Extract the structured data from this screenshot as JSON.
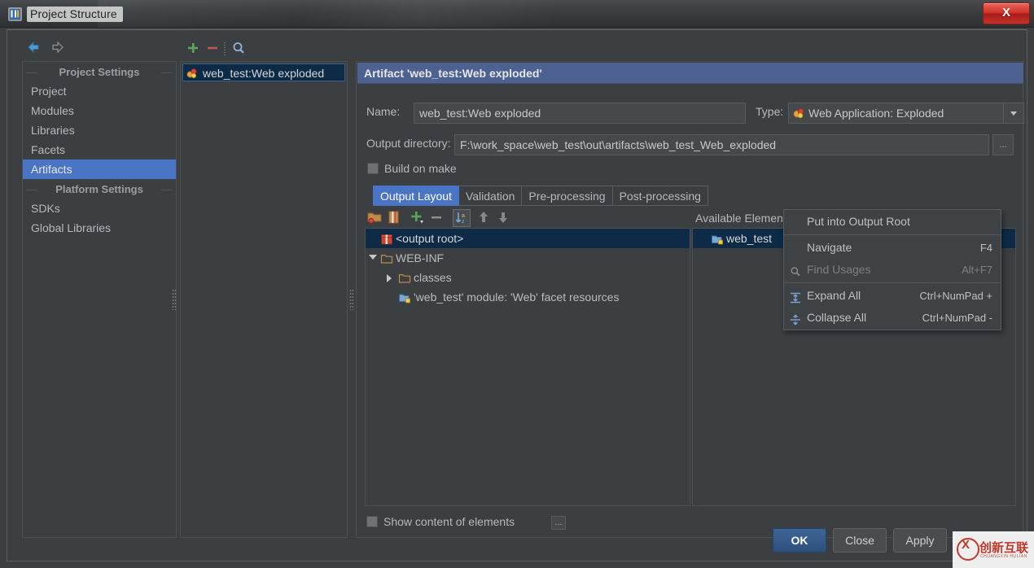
{
  "window": {
    "title": "Project Structure",
    "app_icon": "intellij-idea-icon",
    "close_label": "X"
  },
  "nav": {
    "back_icon": "arrow-left-icon",
    "forward_icon": "arrow-right-icon"
  },
  "sidebar": {
    "groups": [
      {
        "title": "Project Settings",
        "items": [
          {
            "label": "Project",
            "selected": false
          },
          {
            "label": "Modules",
            "selected": false
          },
          {
            "label": "Libraries",
            "selected": false
          },
          {
            "label": "Facets",
            "selected": false
          },
          {
            "label": "Artifacts",
            "selected": true
          }
        ]
      },
      {
        "title": "Platform Settings",
        "items": [
          {
            "label": "SDKs",
            "selected": false
          },
          {
            "label": "Global Libraries",
            "selected": false
          }
        ]
      }
    ]
  },
  "artifacts_panel": {
    "toolbar": {
      "add_icon": "plus-icon",
      "remove_icon": "minus-icon",
      "find_icon": "search-icon"
    },
    "items": [
      {
        "label": "web_test:Web exploded",
        "icon": "artifact-exploded-icon",
        "selected": true
      }
    ]
  },
  "details": {
    "header": "Artifact 'web_test:Web exploded'",
    "name_label": "Name:",
    "name_value": "web_test:Web exploded",
    "type_label": "Type:",
    "type_value": "Web Application: Exploded",
    "type_icon": "web-application-icon",
    "type_dropdown_icon": "chevron-down-icon",
    "output_dir_label": "Output directory:",
    "output_dir_value": "F:\\work_space\\web_test\\out\\artifacts\\web_test_Web_exploded",
    "output_dir_browse": "...",
    "build_on_make_label": "Build on make",
    "build_on_make_checked": false,
    "tabs": [
      {
        "label": "Output Layout",
        "active": true
      },
      {
        "label": "Validation",
        "active": false
      },
      {
        "label": "Pre-processing",
        "active": false
      },
      {
        "label": "Post-processing",
        "active": false
      }
    ],
    "layout_toolbar": [
      {
        "icon": "create-directory-icon",
        "framed": false
      },
      {
        "icon": "create-archive-icon",
        "framed": false
      },
      {
        "icon": "add-copy-of-icon",
        "framed": false
      },
      {
        "icon": "remove-icon",
        "framed": false
      },
      {
        "icon": "sort-alphabetically-icon",
        "framed": true
      },
      {
        "icon": "move-up-icon",
        "framed": false
      },
      {
        "icon": "move-down-icon",
        "framed": false
      }
    ],
    "tree": [
      {
        "label": "<output root>",
        "icon": "output-root-icon",
        "indent": 0,
        "twisty": "none",
        "selected": true
      },
      {
        "label": "WEB-INF",
        "icon": "folder-icon",
        "indent": 0,
        "twisty": "open",
        "selected": false
      },
      {
        "label": "classes",
        "icon": "folder-icon",
        "indent": 1,
        "twisty": "closed",
        "selected": false
      },
      {
        "label": "'web_test' module: 'Web' facet resources",
        "icon": "module-facet-icon",
        "indent": 1,
        "twisty": "none",
        "selected": false
      }
    ],
    "available_header": "Available Elements",
    "available_help": "?",
    "available_items": [
      {
        "label": "web_test",
        "icon": "module-facet-icon",
        "selected": true
      }
    ],
    "show_content_label": "Show content of elements",
    "show_content_checked": false,
    "show_content_more": "..."
  },
  "context_menu": {
    "items": [
      {
        "label": "Put into Output Root",
        "accel": "",
        "icon": "",
        "disabled": false,
        "separator_after": true
      },
      {
        "label": "Navigate",
        "accel": "F4",
        "icon": "",
        "disabled": false,
        "separator_after": false
      },
      {
        "label": "Find Usages",
        "accel": "Alt+F7",
        "icon": "search-icon",
        "disabled": true,
        "separator_after": true
      },
      {
        "label": "Expand All",
        "accel": "Ctrl+NumPad +",
        "icon": "expand-all-icon",
        "disabled": false,
        "separator_after": false
      },
      {
        "label": "Collapse All",
        "accel": "Ctrl+NumPad -",
        "icon": "collapse-all-icon",
        "disabled": false,
        "separator_after": false
      }
    ]
  },
  "buttons": {
    "ok": "OK",
    "close": "Close",
    "apply": "Apply"
  },
  "watermark": {
    "text_cn": "创新互联",
    "text_sub": "CHUANGXIN HULIAN",
    "logo": "x-circle-logo"
  },
  "colors": {
    "accent_blue": "#4a74c4",
    "header_blue": "#4d6291",
    "panel_bg": "#3c3f41",
    "tree_selected": "#0d2b47",
    "close_red": "#d2302a"
  }
}
